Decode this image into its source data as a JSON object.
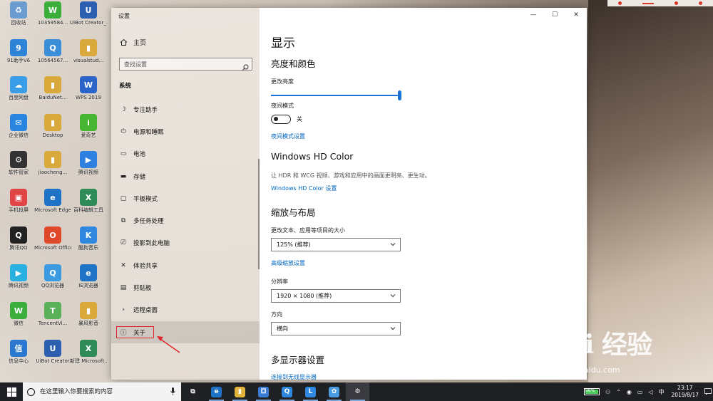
{
  "desktop": {
    "icons": [
      {
        "label": "回收站",
        "color": "#6a9bd1",
        "glyph": "♻"
      },
      {
        "label": "10359584...",
        "color": "#3cae3c",
        "glyph": "W"
      },
      {
        "label": "UiBot Creator_...",
        "color": "#2c5fb0",
        "glyph": "U"
      },
      {
        "label": "91助手V6",
        "color": "#2d83d6",
        "glyph": "9"
      },
      {
        "label": "10564567...",
        "color": "#3b8fd8",
        "glyph": "Q"
      },
      {
        "label": "visualstud...",
        "color": "#d9a93c",
        "glyph": "▮"
      },
      {
        "label": "百度网盘",
        "color": "#3a9de8",
        "glyph": "☁"
      },
      {
        "label": "BaiduNet...",
        "color": "#d9a93c",
        "glyph": "▮"
      },
      {
        "label": "WPS 2019",
        "color": "#2b64c8",
        "glyph": "W"
      },
      {
        "label": "企业微信",
        "color": "#2a85e0",
        "glyph": "✉"
      },
      {
        "label": "Desktop",
        "color": "#d9a93c",
        "glyph": "▮"
      },
      {
        "label": "爱奇艺",
        "color": "#47b531",
        "glyph": "i"
      },
      {
        "label": "软件管家",
        "color": "#333333",
        "glyph": "⚙"
      },
      {
        "label": "jiaocheng...",
        "color": "#d9a93c",
        "glyph": "▮"
      },
      {
        "label": "腾讯视频",
        "color": "#2d7fe0",
        "glyph": "▶"
      },
      {
        "label": "手机投屏",
        "color": "#e04444",
        "glyph": "▣"
      },
      {
        "label": "Microsoft Edge",
        "color": "#1f73c6",
        "glyph": "e"
      },
      {
        "label": "百科编辑工具",
        "color": "#2e8b57",
        "glyph": "X"
      },
      {
        "label": "腾讯QQ",
        "color": "#222222",
        "glyph": "Q"
      },
      {
        "label": "Microsoft Office",
        "color": "#e0482c",
        "glyph": "O"
      },
      {
        "label": "酷狗音乐",
        "color": "#2f87e0",
        "glyph": "K"
      },
      {
        "label": "腾讯视频",
        "color": "#28b0e0",
        "glyph": "▶"
      },
      {
        "label": "QQ浏览器",
        "color": "#3b9ae0",
        "glyph": "Q"
      },
      {
        "label": "IE浏览器",
        "color": "#1f73c6",
        "glyph": "e"
      },
      {
        "label": "微信",
        "color": "#3cae3c",
        "glyph": "W"
      },
      {
        "label": "TencentVi...",
        "color": "#5ab15a",
        "glyph": "T"
      },
      {
        "label": "暴风影音",
        "color": "#d9a93c",
        "glyph": "▮"
      },
      {
        "label": "信息中心",
        "color": "#2a78d0",
        "glyph": "信"
      },
      {
        "label": "UiBot Creator",
        "color": "#2c5fb0",
        "glyph": "U"
      },
      {
        "label": "新建 Microsoft...",
        "color": "#2e8b57",
        "glyph": "X"
      }
    ]
  },
  "window": {
    "title": "设置",
    "controls": {
      "minimize": "—",
      "maximize": "☐",
      "close": "✕"
    }
  },
  "nav": {
    "home_label": "主页",
    "search_placeholder": "查找设置",
    "section_label": "系统",
    "items": [
      {
        "label": "专注助手",
        "icon": "moon-icon",
        "glyph": "☽"
      },
      {
        "label": "电源和睡眠",
        "icon": "power-icon",
        "glyph": "⏻"
      },
      {
        "label": "电池",
        "icon": "battery-icon",
        "glyph": "▭"
      },
      {
        "label": "存储",
        "icon": "storage-icon",
        "glyph": "▬"
      },
      {
        "label": "平板模式",
        "icon": "tablet-icon",
        "glyph": "▢"
      },
      {
        "label": "多任务处理",
        "icon": "multitask-icon",
        "glyph": "⧉"
      },
      {
        "label": "投影到此电脑",
        "icon": "project-icon",
        "glyph": "⎚"
      },
      {
        "label": "体验共享",
        "icon": "share-icon",
        "glyph": "✕"
      },
      {
        "label": "剪贴板",
        "icon": "clipboard-icon",
        "glyph": "▤"
      },
      {
        "label": "远程桌面",
        "icon": "remote-icon",
        "glyph": "›"
      },
      {
        "label": "关于",
        "icon": "info-icon",
        "glyph": "ⓘ"
      }
    ]
  },
  "content": {
    "page_title": "显示",
    "brightness": {
      "heading": "亮度和颜色",
      "slider_label": "更改亮度",
      "value_percent": 100
    },
    "night_light": {
      "label": "夜间模式",
      "state_text": "关",
      "settings_link": "夜间模式设置"
    },
    "hd_color": {
      "heading": "Windows HD Color",
      "description": "让 HDR 和 WCG 视频、游戏和应用中的画面更明亮、更生动。",
      "link": "Windows HD Color 设置"
    },
    "scale_layout": {
      "heading": "缩放与布局",
      "scale_label": "更改文本、应用等项目的大小",
      "scale_value": "125% (推荐)",
      "advanced_link": "高级缩放设置",
      "resolution_label": "分辨率",
      "resolution_value": "1920 × 1080 (推荐)",
      "orientation_label": "方向",
      "orientation_value": "横向"
    },
    "multi_display": {
      "heading": "多显示器设置",
      "link": "连接到无线显示器"
    }
  },
  "taskbar": {
    "search_placeholder": "在这里输入你要搜索的内容",
    "apps": [
      {
        "name": "task-view",
        "glyph": "⧉",
        "color": "#1f2024"
      },
      {
        "name": "edge",
        "glyph": "e",
        "color": "#1f73c6"
      },
      {
        "name": "file-explorer",
        "glyph": "▮",
        "color": "#e0b43c"
      },
      {
        "name": "store",
        "glyph": "⛋",
        "color": "#3a7bd5"
      },
      {
        "name": "browser",
        "glyph": "Q",
        "color": "#2f87e0"
      },
      {
        "name": "app-l",
        "glyph": "L",
        "color": "#2f87e0"
      },
      {
        "name": "app-photo",
        "glyph": "✿",
        "color": "#4b9be0"
      },
      {
        "name": "settings",
        "glyph": "⚙",
        "color": "#3a3b40"
      }
    ],
    "battery_percent": "98%",
    "battery_level": 0.98,
    "ime": "中",
    "time": "23:17",
    "date": "2019/8/17"
  },
  "watermark": {
    "brand": "Bai  经验",
    "url": "jingyan.baidu.com"
  },
  "colors": {
    "accent": "#0067c0",
    "slider": "#1a73d9",
    "highlight_box": "#e0252a",
    "taskbar": "#1f2024"
  }
}
